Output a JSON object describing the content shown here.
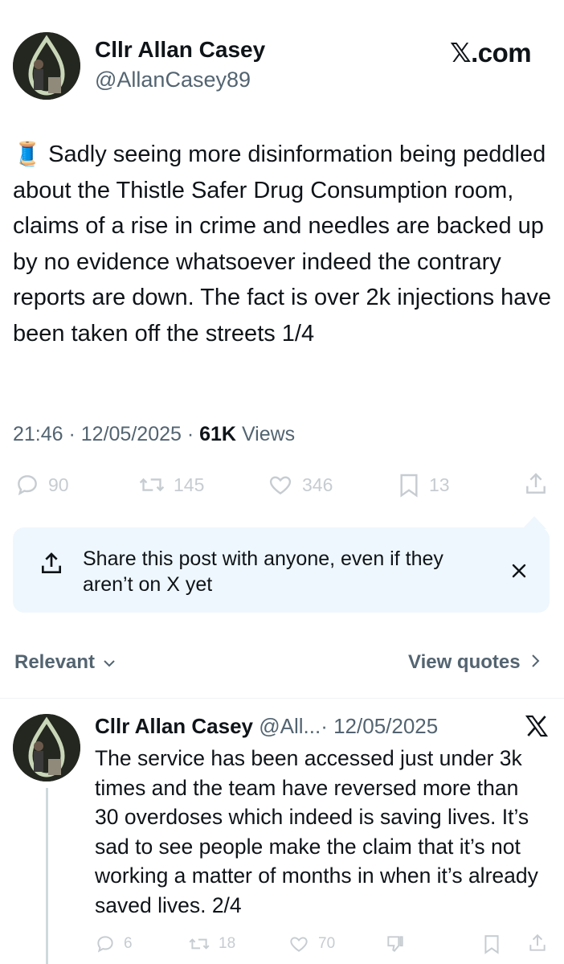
{
  "main_post": {
    "author_name": "Cllr Allan Casey",
    "author_handle": "@AllanCasey89",
    "brand": "𝕏.com",
    "emoji": "🧵",
    "text": "Sadly seeing more disinformation being peddled about the Thistle Safer Drug Consumption room, claims of a rise in crime and needles are backed up by no evidence whatsoever indeed the contrary reports are down. The fact is over 2k injections have been taken off the streets 1/4",
    "time": "21:46 · 12/05/2025 · ",
    "views_count": "61K",
    "views_label": " Views",
    "actions": {
      "replies": "90",
      "reposts": "145",
      "likes": "346",
      "bookmarks": "13"
    }
  },
  "share_prompt": {
    "text": "Share this post with anyone, even if they aren’t on X yet"
  },
  "reply_bar": {
    "sort_label": "Relevant",
    "view_quotes": "View quotes"
  },
  "reply_post": {
    "author_name": "Cllr Allan Casey",
    "author_handle": "@All...",
    "date": "· 12/05/2025",
    "text": "The service has been accessed just under 3k times and the team have reversed more than 30 overdoses which indeed is saving lives. It’s sad to see people make the claim that it’s not working a matter of months in when it’s already saved lives. 2/4",
    "actions": {
      "replies": "6",
      "reposts": "18",
      "likes": "70"
    }
  },
  "colors": {
    "text": "#0f1419",
    "secondary": "#536471",
    "share_bg": "#eef7fd",
    "action_muted": "#c6ccd1"
  }
}
